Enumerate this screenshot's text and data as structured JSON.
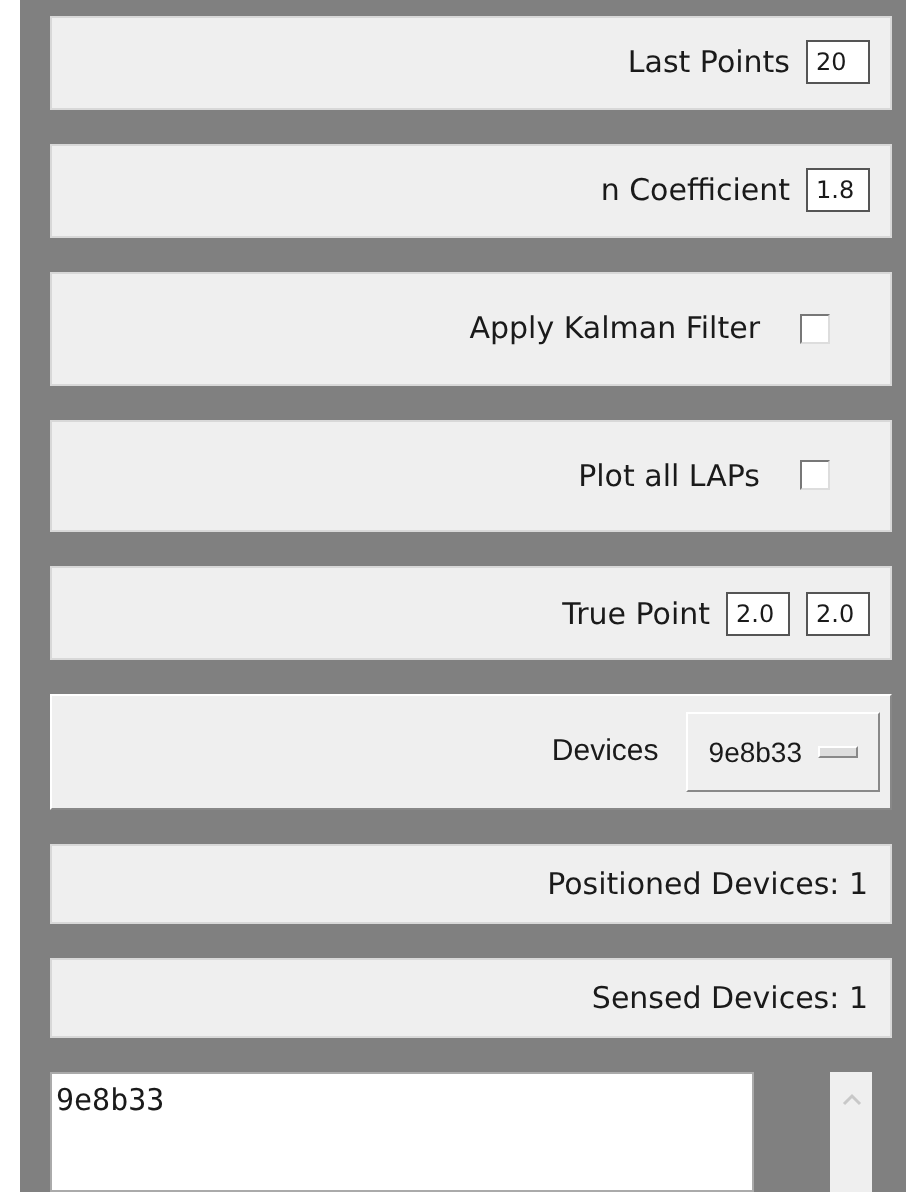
{
  "rows": [
    {
      "kind": "field",
      "label": "Last Points",
      "values": [
        "20"
      ]
    },
    {
      "kind": "field",
      "label": "n Coefficient",
      "values": [
        "1.8"
      ]
    },
    {
      "kind": "checkbox",
      "label": "Apply Kalman Filter",
      "checked": false
    },
    {
      "kind": "checkbox",
      "label": "Plot all LAPs",
      "checked": false
    },
    {
      "kind": "field",
      "label": "True Point",
      "values": [
        "2.0",
        "2.0"
      ]
    },
    {
      "kind": "dropdown",
      "label": "Devices",
      "value": "9e8b33"
    },
    {
      "kind": "info",
      "label": "Positioned Devices: 1"
    },
    {
      "kind": "info",
      "label": "Sensed Devices: 1"
    }
  ],
  "log": {
    "value": "9e8b33"
  }
}
